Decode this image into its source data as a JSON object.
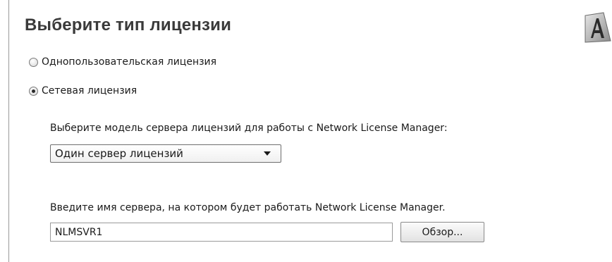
{
  "page": {
    "title": "Выберите тип лицензии"
  },
  "license_type": {
    "options": [
      {
        "label": "Однопользовательская лицензия",
        "checked": false
      },
      {
        "label": "Сетевая лицензия",
        "checked": true
      }
    ]
  },
  "server_model": {
    "prompt": "Выберите модель сервера лицензий для работы с Network License Manager:",
    "selected": "Один сервер лицензий"
  },
  "server_name": {
    "prompt": "Введите имя сервера, на котором будет работать Network License Manager.",
    "value": "NLMSVR1",
    "browse_label": "Обзор..."
  },
  "icons": {
    "logo": "autodesk-a-logo-icon",
    "dropdown": "chevron-down-icon"
  }
}
